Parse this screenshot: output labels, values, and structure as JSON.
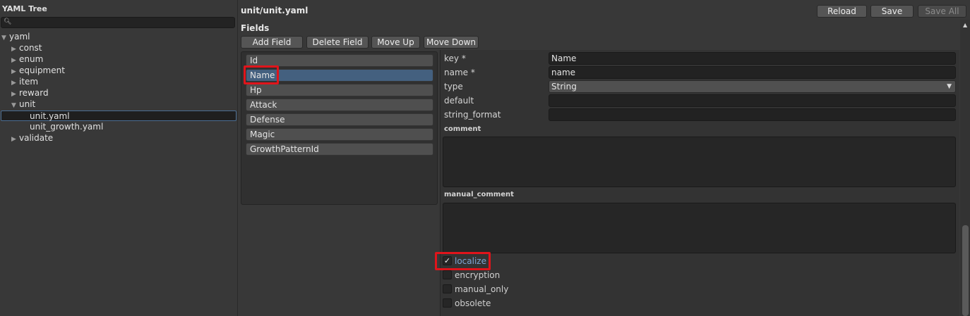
{
  "tree": {
    "title": "YAML Tree",
    "search_placeholder": "",
    "nodes": [
      {
        "label": "yaml",
        "arrow": "▼"
      },
      {
        "label": "const",
        "arrow": "▶"
      },
      {
        "label": "enum",
        "arrow": "▶"
      },
      {
        "label": "equipment",
        "arrow": "▶"
      },
      {
        "label": "item",
        "arrow": "▶"
      },
      {
        "label": "reward",
        "arrow": "▶"
      },
      {
        "label": "unit",
        "arrow": "▼"
      },
      {
        "label": "unit.yaml",
        "arrow": ""
      },
      {
        "label": "unit_growth.yaml",
        "arrow": ""
      },
      {
        "label": "validate",
        "arrow": "▶"
      }
    ],
    "selected_node": "unit.yaml"
  },
  "header": {
    "path": "unit/unit.yaml",
    "reload_label": "Reload",
    "save_label": "Save",
    "save_all_label": "Save All"
  },
  "fields": {
    "title": "Fields",
    "add_label": "Add Field",
    "delete_label": "Delete Field",
    "move_up_label": "Move Up",
    "move_down_label": "Move Down",
    "items": [
      "Id",
      "Name",
      "Hp",
      "Attack",
      "Defense",
      "Magic",
      "GrowthPatternId"
    ],
    "selected": "Name"
  },
  "detail": {
    "key_label": "key *",
    "key_value": "Name",
    "name_label": "name *",
    "name_value": "name",
    "type_label": "type",
    "type_value": "String",
    "default_label": "default",
    "default_value": "",
    "string_format_label": "string_format",
    "string_format_value": "",
    "comment_label": "comment",
    "manual_comment_label": "manual_comment",
    "checks": [
      {
        "label": "localize",
        "checked": true
      },
      {
        "label": "encryption",
        "checked": false
      },
      {
        "label": "manual_only",
        "checked": false
      },
      {
        "label": "obsolete",
        "checked": false
      }
    ]
  },
  "icons": {
    "search": "magnifier-icon",
    "dropdown": "chevron-down-icon",
    "check": "✓",
    "scroll_up": "▲"
  },
  "colors": {
    "selected_field": "#44607f",
    "highlight": "#e0141b",
    "checked_text": "#7ea6d4"
  }
}
